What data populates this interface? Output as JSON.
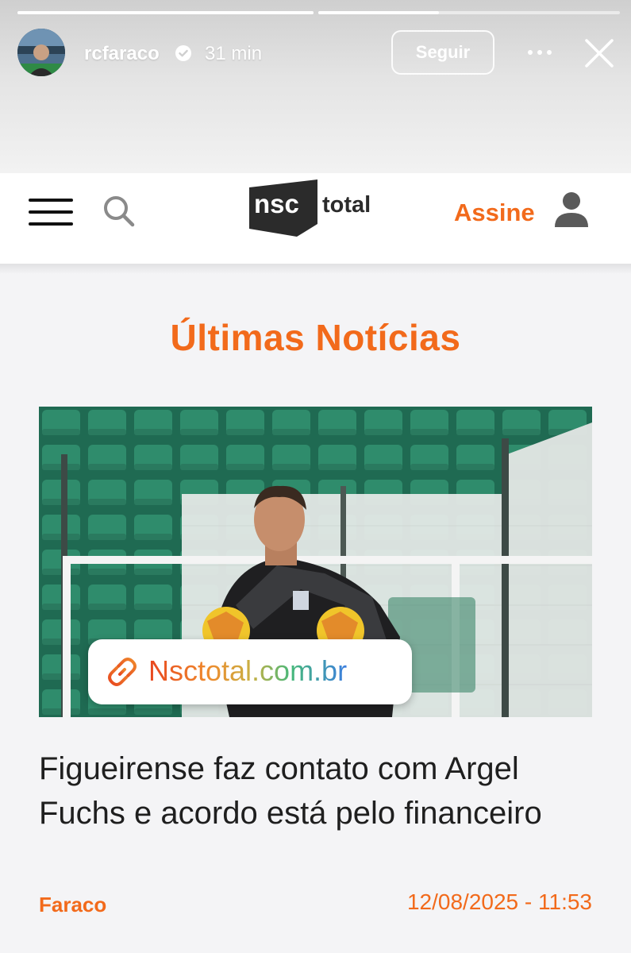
{
  "story": {
    "username": "rcfaraco",
    "time": "31 min",
    "follow_label": "Seguir",
    "icons": [
      "avatar",
      "verified-badge-icon",
      "more-options-icon",
      "close-icon"
    ],
    "progress": [
      1.0,
      0.4
    ]
  },
  "site_header": {
    "logo_nsc": "nsc",
    "logo_total": "total",
    "subscribe_label": "Assine",
    "icons": [
      "menu-icon",
      "search-icon",
      "user-icon"
    ]
  },
  "section": {
    "title": "Últimas Notícias"
  },
  "article": {
    "headline": "Figueirense faz contato com Argel Fuchs e acordo está pelo financeiro",
    "author": "Faraco",
    "date": "12/08/2025 - 11:53",
    "link_sticker": "Nsctotal.com.br"
  },
  "colors": {
    "accent": "#f26a1b",
    "headline": "#1f1f1f",
    "stadium_seats": "#2b7c64"
  }
}
